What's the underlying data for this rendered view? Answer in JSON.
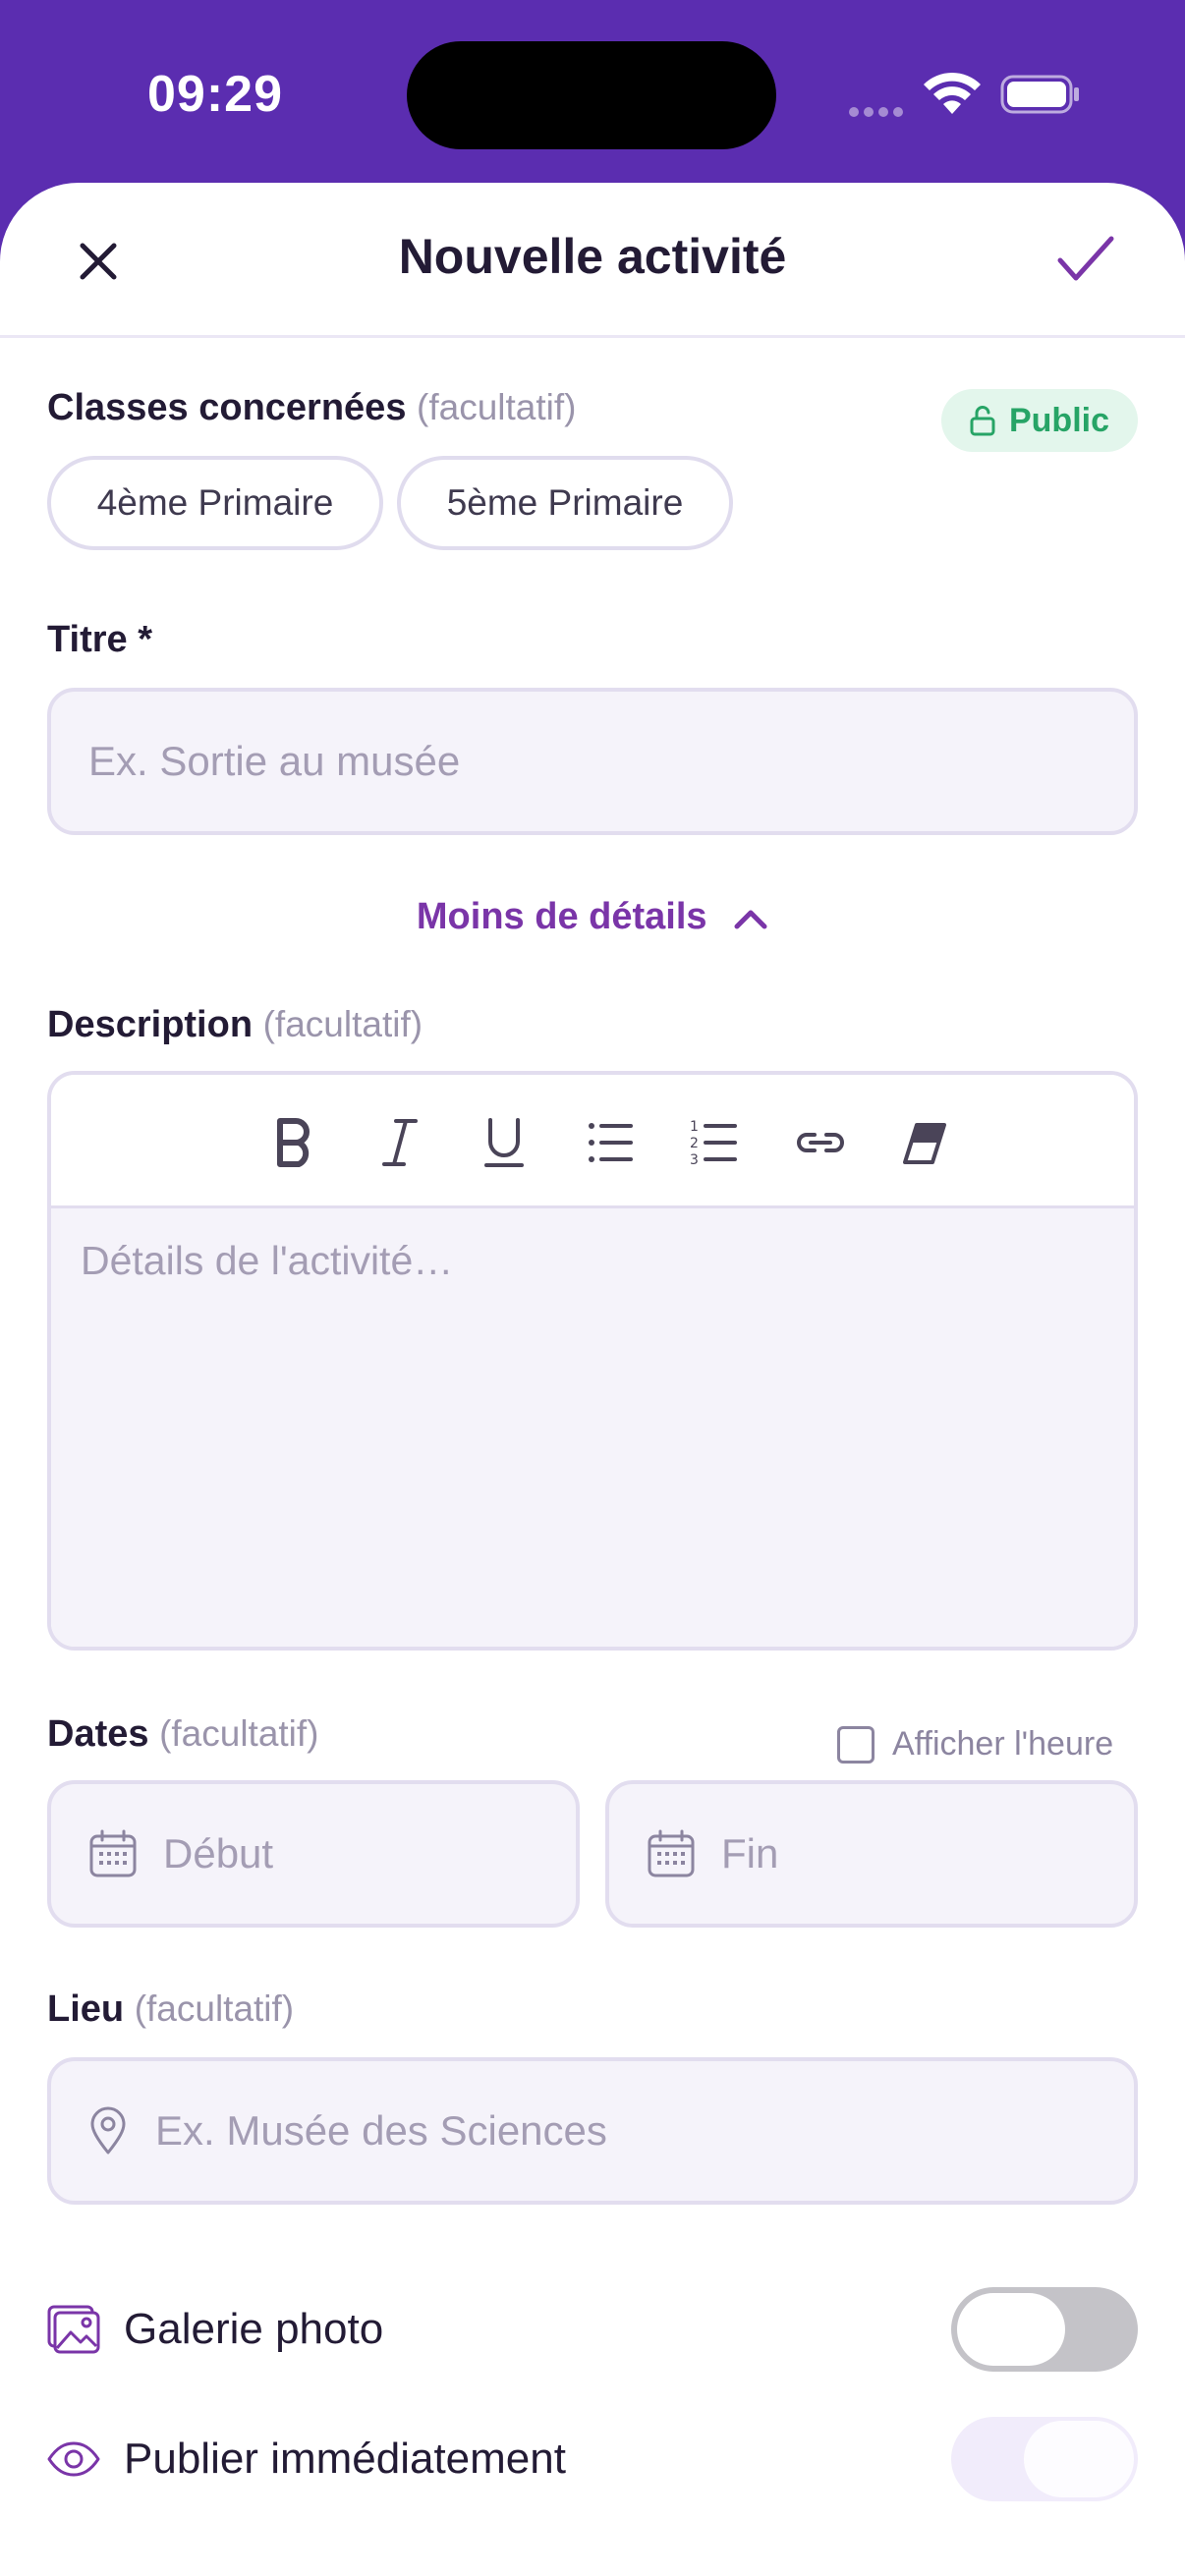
{
  "status_bar": {
    "time": "09:29"
  },
  "header": {
    "title": "Nouvelle activité"
  },
  "classes": {
    "label": "Classes concernées",
    "optional": "(facultatif)",
    "visibility_badge": "Public",
    "chips": [
      "4ème Primaire",
      "5ème Primaire"
    ]
  },
  "title_field": {
    "label": "Titre *",
    "placeholder": "Ex. Sortie au musée"
  },
  "toggle_details": {
    "label": "Moins de détails"
  },
  "description": {
    "label": "Description",
    "optional": "(facultatif)",
    "placeholder": "Détails de l'activité…",
    "toolbar": [
      "bold-icon",
      "italic-icon",
      "underline-icon",
      "bullet-list-icon",
      "numbered-list-icon",
      "link-icon",
      "clear-format-icon"
    ]
  },
  "dates": {
    "label": "Dates",
    "optional": "(facultatif)",
    "show_time_label": "Afficher l'heure",
    "show_time_checked": false,
    "start_placeholder": "Début",
    "end_placeholder": "Fin"
  },
  "location": {
    "label": "Lieu",
    "optional": "(facultatif)",
    "placeholder": "Ex. Musée des Sciences"
  },
  "options": {
    "gallery": {
      "label": "Galerie photo",
      "enabled": false
    },
    "publish": {
      "label": "Publier immédiatement",
      "enabled": false
    }
  },
  "colors": {
    "brand": "#5b2db0",
    "accent": "#7a35a8",
    "success": "#27a466"
  }
}
